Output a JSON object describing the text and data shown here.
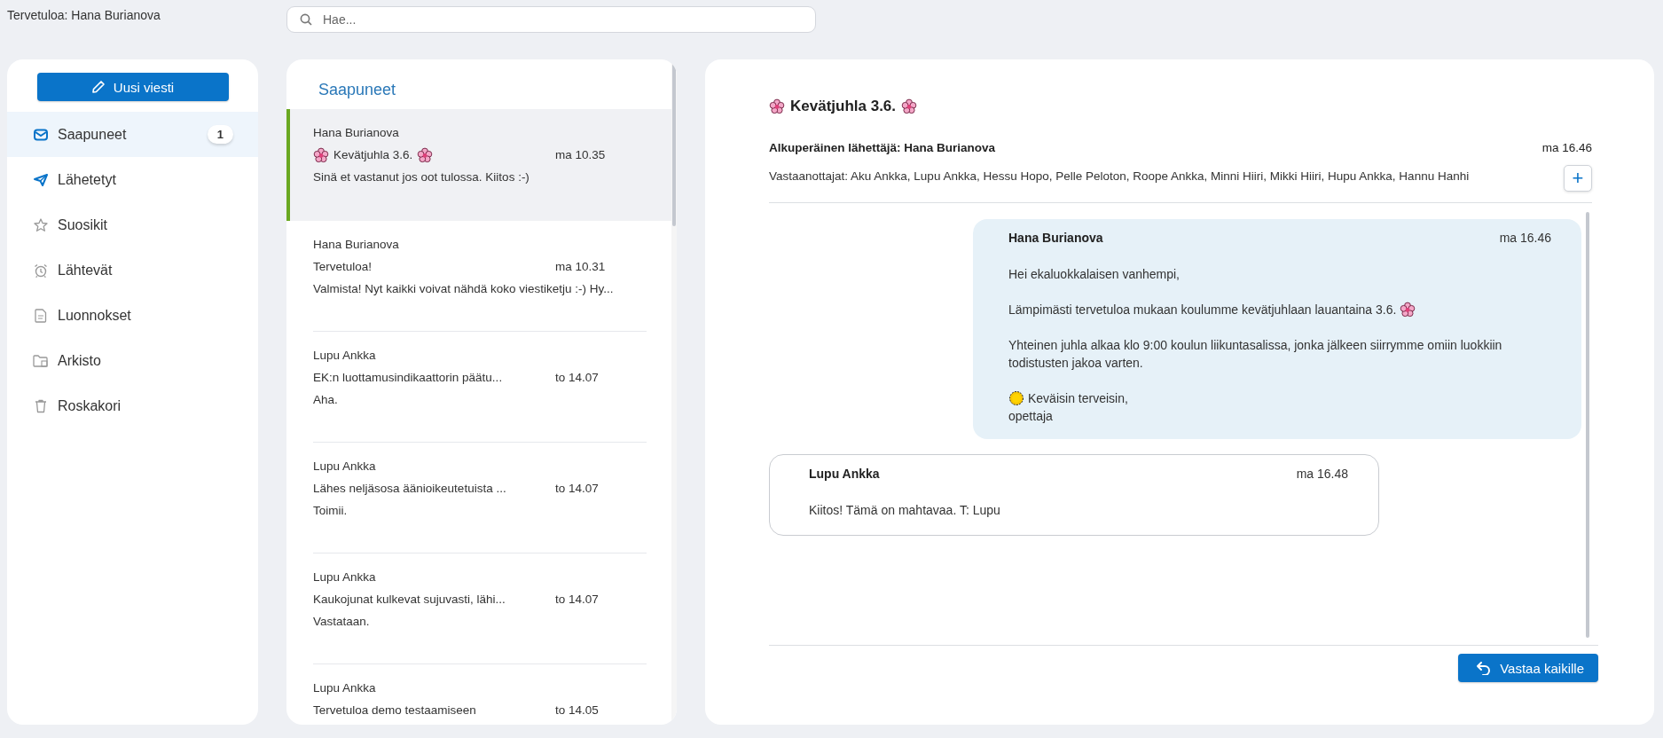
{
  "header": {
    "welcome": "Tervetuloa: Hana Burianova",
    "search": {
      "placeholder": "Hae..."
    }
  },
  "sidebar": {
    "new_button": "Uusi viesti",
    "items": [
      {
        "label": "Saapuneet",
        "selected": true,
        "badge": "1"
      },
      {
        "label": "Lähetetyt",
        "selected": false
      },
      {
        "label": "Suosikit",
        "selected": false
      },
      {
        "label": "Lähtevät",
        "selected": false
      },
      {
        "label": "Luonnokset",
        "selected": false
      },
      {
        "label": "Arkisto",
        "selected": false
      },
      {
        "label": "Roskakori",
        "selected": false
      }
    ]
  },
  "message_list": {
    "title": "Saapuneet",
    "items": [
      {
        "sender": "Hana Burianova",
        "subject": "Kevätjuhla 3.6.",
        "flowers": true,
        "time": "ma 10.35",
        "preview": "Sinä et vastanut jos oot tulossa. Kiitos :-)",
        "selected": true
      },
      {
        "sender": "Hana Burianova",
        "subject": "Tervetuloa!",
        "time": "ma 10.31",
        "preview": "Valmista! Nyt kaikki voivat nähdä koko viestiketju :-) Hy...",
        "selected": false
      },
      {
        "sender": "Lupu Ankka",
        "subject": "EK:n luottamusindikaattorin päätu...",
        "time": "to 14.07",
        "preview": "Aha.",
        "selected": false
      },
      {
        "sender": "Lupu Ankka",
        "subject": "Lähes neljäsosa äänioikeutetuista ...",
        "time": "to 14.07",
        "preview": "Toimii.",
        "selected": false
      },
      {
        "sender": "Lupu Ankka",
        "subject": "Kaukojunat kulkevat sujuvasti, lähi...",
        "time": "to 14.07",
        "preview": "Vastataan.",
        "selected": false
      },
      {
        "sender": "Lupu Ankka",
        "subject": "Tervetuloa demo testaamiseen",
        "time": "to 14.05",
        "selected": false
      }
    ]
  },
  "thread": {
    "title": "Kevätjuhla 3.6.",
    "flowers": true,
    "original_sender": "Alkuperäinen lähettäjä: Hana Burianova",
    "time": "ma 16.46",
    "recipients": "Vastaanottajat: Aku Ankka, Lupu Ankka, Hessu Hopo, Pelle Peloton, Roope Ankka, Minni Hiiri, Mikki Hiiri, Hupu Ankka, Hannu Hanhi",
    "expand_button": "+",
    "messages": [
      {
        "kind": "own",
        "sender": "Hana Burianova",
        "time": "ma 16.46",
        "paragraphs": [
          {
            "lines": [
              "Hei ekaluokkalaisen vanhempi,"
            ]
          },
          {
            "lines": [
              "Lämpimästi tervetuloa mukaan koulumme kevätjuhlaan lauantaina 3.6."
            ],
            "flower_after": true
          },
          {
            "lines": [
              "Yhteinen juhla alkaa klo 9:00 koulun liikuntasalissa, jonka jälkeen siirrymme omiin luokkiin todistusten jakoa varten."
            ]
          },
          {
            "lines": [
              "Keväisin terveisin,",
              "opettaja"
            ],
            "sun_before": true
          }
        ]
      },
      {
        "kind": "other",
        "sender": "Lupu Ankka",
        "time": "ma 16.48",
        "paragraphs": [
          {
            "lines": [
              "Kiitos! Tämä on mahtavaa. T: Lupu"
            ]
          }
        ]
      }
    ],
    "reply_button": "Vastaa kaikille"
  }
}
